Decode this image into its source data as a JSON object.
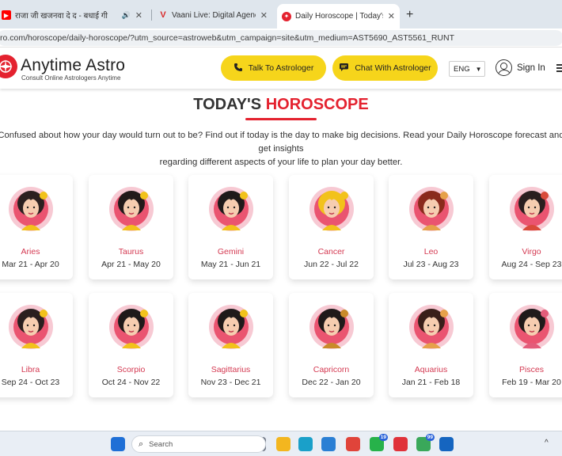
{
  "browser": {
    "tabs": [
      {
        "title": "राजा जी खजनवा दे द - बधाई गी",
        "favicon": "youtube-icon",
        "favicon_color": "#ff0000",
        "extra": "🔊"
      },
      {
        "title": "Vaani Live: Digital Agency, Web",
        "favicon": "v-logo-icon",
        "favicon_color": "#d92b2b"
      },
      {
        "title": "Daily Horoscope | Today's Free",
        "favicon": "anytime-astro-icon",
        "favicon_color": "#e4222f",
        "active": true
      }
    ],
    "close_glyph": "✕",
    "new_tab_glyph": "+",
    "address": "ro.com/horoscope/daily-horoscope/?utm_source=astroweb&utm_campaign=site&utm_medium=AST5690_AST5561_RUNT"
  },
  "header": {
    "brand": "Anytime Astro",
    "tagline": "Consult Online Astrologers Anytime",
    "talk_label": "Talk To Astrologer",
    "chat_label": "Chat With Astrologer",
    "language": "ENG",
    "signin_label": "Sign In",
    "accent": "#e4222f",
    "button_color": "#f6d51b"
  },
  "main": {
    "title_part1": "TODAY'S",
    "title_part2": "HOROSCOPE",
    "intro_line1": "Confused about how your day would turn out to be? Find out if today is the day to make big decisions. Read your Daily Horoscope forecast and get insights",
    "intro_line2": "regarding different aspects of your life to plan your day better."
  },
  "signs": [
    {
      "name": "Aries",
      "dates": "Mar 21 - Apr 20",
      "icon": "aries-woman-icon",
      "hair": "#2b2020",
      "accent": "#f2c21b"
    },
    {
      "name": "Taurus",
      "dates": "Apr 21 - May 20",
      "icon": "taurus-woman-icon",
      "hair": "#231a1a",
      "accent": "#f2c21b"
    },
    {
      "name": "Gemini",
      "dates": "May 21 - Jun 21",
      "icon": "gemini-woman-icon",
      "hair": "#1f1a1a",
      "accent": "#f2c21b"
    },
    {
      "name": "Cancer",
      "dates": "Jun 22 - Jul 22",
      "icon": "cancer-woman-icon",
      "hair": "#f2c21b",
      "accent": "#f2c21b"
    },
    {
      "name": "Leo",
      "dates": "Jul 23 - Aug 23",
      "icon": "leo-woman-icon",
      "hair": "#8a2a1c",
      "accent": "#e6a14a"
    },
    {
      "name": "Virgo",
      "dates": "Aug 24 - Sep 23",
      "icon": "virgo-woman-icon",
      "hair": "#2a1f1f",
      "accent": "#d94a3a"
    },
    {
      "name": "Libra",
      "dates": "Sep 24 - Oct 23",
      "icon": "libra-woman-icon",
      "hair": "#2a1f1f",
      "accent": "#f2c21b"
    },
    {
      "name": "Scorpio",
      "dates": "Oct 24 - Nov 22",
      "icon": "scorpio-woman-icon",
      "hair": "#1f1a1a",
      "accent": "#f2c21b"
    },
    {
      "name": "Sagittarius",
      "dates": "Nov 23 - Dec 21",
      "icon": "sagittarius-woman-icon",
      "hair": "#1f1a1a",
      "accent": "#f2c21b"
    },
    {
      "name": "Capricorn",
      "dates": "Dec 22 - Jan 20",
      "icon": "capricorn-woman-icon",
      "hair": "#1f1a1a",
      "accent": "#c98a2a"
    },
    {
      "name": "Aquarius",
      "dates": "Jan 21 - Feb 18",
      "icon": "aquarius-woman-icon",
      "hair": "#3a1f1a",
      "accent": "#e6a14a"
    },
    {
      "name": "Pisces",
      "dates": "Feb 19 - Mar 20",
      "icon": "pisces-woman-icon",
      "hair": "#1f1a1a",
      "accent": "#e35c7a"
    }
  ],
  "taskbar": {
    "search_placeholder": "Search",
    "apps": [
      {
        "icon": "windows-start-icon",
        "color": "#1f6fd6"
      },
      {
        "icon": "pagoda-widget-icon",
        "color": "#e08a2a"
      },
      {
        "icon": "task-view-icon",
        "color": "#6b7280"
      },
      {
        "icon": "file-explorer-icon",
        "color": "#f3b61f"
      },
      {
        "icon": "edge-icon",
        "color": "#1aa0c9"
      },
      {
        "icon": "vscode-icon",
        "color": "#2a7fd4"
      },
      {
        "icon": "chrome-icon",
        "color": "#e0443a"
      },
      {
        "icon": "whatsapp-icon",
        "color": "#27b24a",
        "badge": "19"
      },
      {
        "icon": "youtube-music-icon",
        "color": "#e0323a"
      },
      {
        "icon": "chrome-profile-icon",
        "color": "#3aa85a",
        "badge": "99"
      },
      {
        "icon": "outlook-icon",
        "color": "#1565c0"
      }
    ],
    "tray_caret": "^"
  }
}
